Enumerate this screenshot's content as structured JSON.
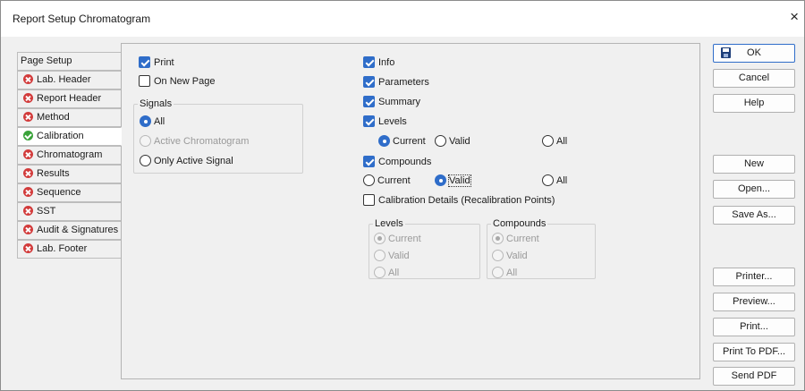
{
  "window": {
    "title": "Report Setup Chromatogram",
    "close_symbol": "×"
  },
  "tabs": [
    {
      "label": "Page Setup",
      "status": "none"
    },
    {
      "label": "Lab. Header",
      "status": "error"
    },
    {
      "label": "Report Header",
      "status": "error"
    },
    {
      "label": "Method",
      "status": "error"
    },
    {
      "label": "Calibration",
      "status": "ok",
      "active": true
    },
    {
      "label": "Chromatogram",
      "status": "error"
    },
    {
      "label": "Results",
      "status": "error"
    },
    {
      "label": "Sequence",
      "status": "error"
    },
    {
      "label": "SST",
      "status": "error"
    },
    {
      "label": "Audit & Signatures",
      "status": "error"
    },
    {
      "label": "Lab. Footer",
      "status": "error"
    }
  ],
  "left": {
    "print": {
      "label": "Print",
      "checked": true
    },
    "on_new_page": {
      "label": "On New Page",
      "checked": false
    },
    "signals": {
      "title": "Signals",
      "options": [
        {
          "label": "All",
          "selected": true,
          "enabled": true
        },
        {
          "label": "Active Chromatogram",
          "selected": false,
          "enabled": false
        },
        {
          "label": "Only Active Signal",
          "selected": false,
          "enabled": true
        }
      ]
    }
  },
  "right": {
    "info": {
      "label": "Info",
      "checked": true
    },
    "parameters": {
      "label": "Parameters",
      "checked": true
    },
    "summary": {
      "label": "Summary",
      "checked": true
    },
    "levels": {
      "label": "Levels",
      "checked": true
    },
    "levels_options": [
      {
        "label": "Current",
        "selected": true
      },
      {
        "label": "Valid",
        "selected": false
      },
      {
        "label": "All",
        "selected": false
      }
    ],
    "compounds": {
      "label": "Compounds",
      "checked": true
    },
    "compounds_options": [
      {
        "label": "Current",
        "selected": false
      },
      {
        "label": "Valid",
        "selected": true
      },
      {
        "label": "All",
        "selected": false
      }
    ],
    "calibration_details": {
      "label": "Calibration Details (Recalibration Points)",
      "checked": false
    },
    "details_levels": {
      "title": "Levels",
      "options": [
        {
          "label": "Current",
          "selected": true
        },
        {
          "label": "Valid",
          "selected": false
        },
        {
          "label": "All",
          "selected": false
        }
      ]
    },
    "details_compounds": {
      "title": "Compounds",
      "options": [
        {
          "label": "Current",
          "selected": true
        },
        {
          "label": "Valid",
          "selected": false
        },
        {
          "label": "All",
          "selected": false
        }
      ]
    }
  },
  "buttons": {
    "ok": "OK",
    "cancel": "Cancel",
    "help": "Help",
    "new": "New",
    "open": "Open...",
    "save_as": "Save As...",
    "printer": "Printer...",
    "preview": "Preview...",
    "print": "Print...",
    "print_to_pdf": "Print To PDF...",
    "send_pdf": "Send PDF"
  },
  "colors": {
    "accent": "#2f6dc9",
    "error": "#d23b3b",
    "ok": "#3aa33a"
  }
}
